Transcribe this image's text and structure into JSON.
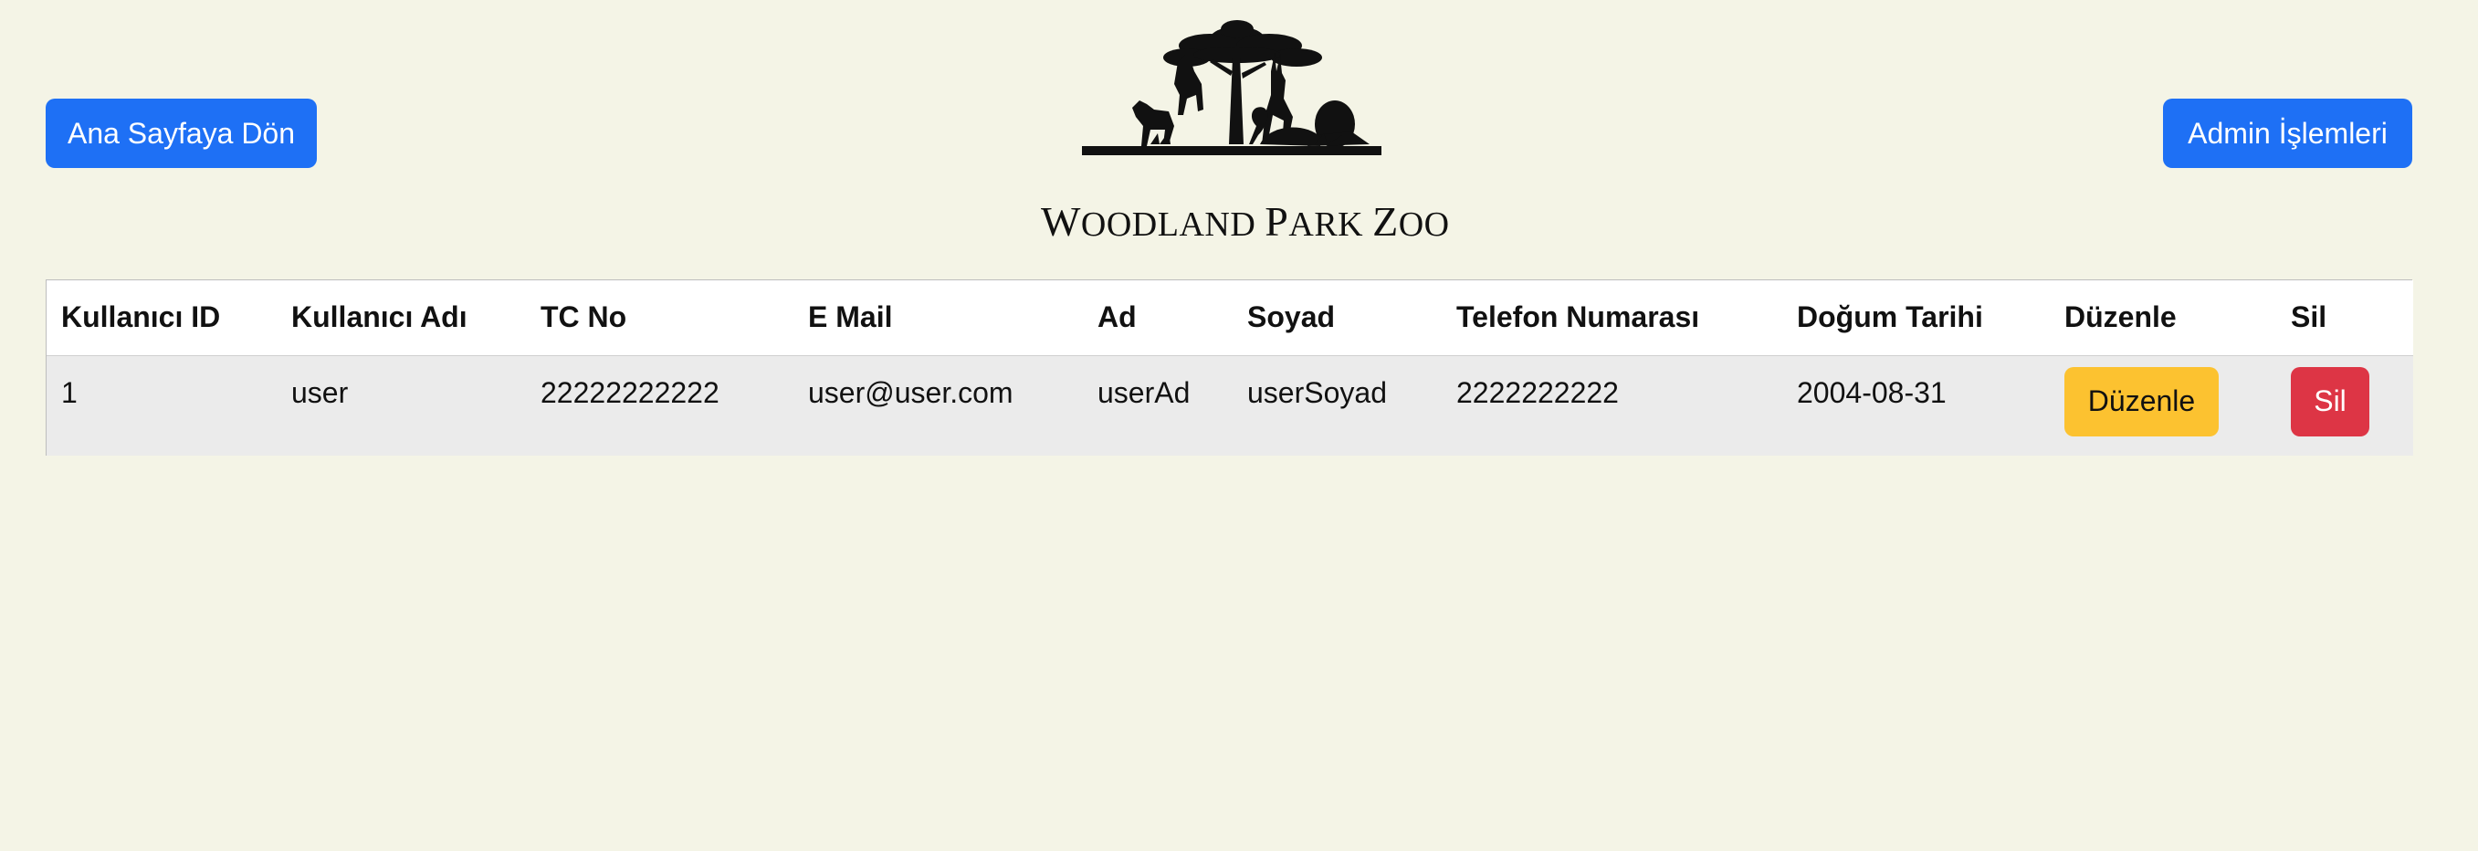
{
  "header": {
    "home_button": "Ana Sayfaya Dön",
    "admin_button": "Admin İşlemleri",
    "logo_text_initial_1": "W",
    "logo_text_rest_1": "OODLAND",
    "logo_text_initial_2": "P",
    "logo_text_rest_2": "ARK",
    "logo_text_initial_3": "Z",
    "logo_text_rest_3": "OO"
  },
  "table": {
    "columns": [
      "Kullanıcı ID",
      "Kullanıcı Adı",
      "TC No",
      "E Mail",
      "Ad",
      "Soyad",
      "Telefon Numarası",
      "Doğum Tarihi",
      "Düzenle",
      "Sil"
    ],
    "rows": [
      {
        "id": "1",
        "username": "user",
        "tc_no": "22222222222",
        "email": "user@user.com",
        "first_name": "userAd",
        "last_name": "userSoyad",
        "phone": "2222222222",
        "birth_date": "2004-08-31",
        "edit_label": "Düzenle",
        "delete_label": "Sil"
      }
    ]
  },
  "colors": {
    "background": "#f4f4e6",
    "primary": "#1e70f5",
    "warning": "#fcc230",
    "danger": "#dd3545"
  }
}
